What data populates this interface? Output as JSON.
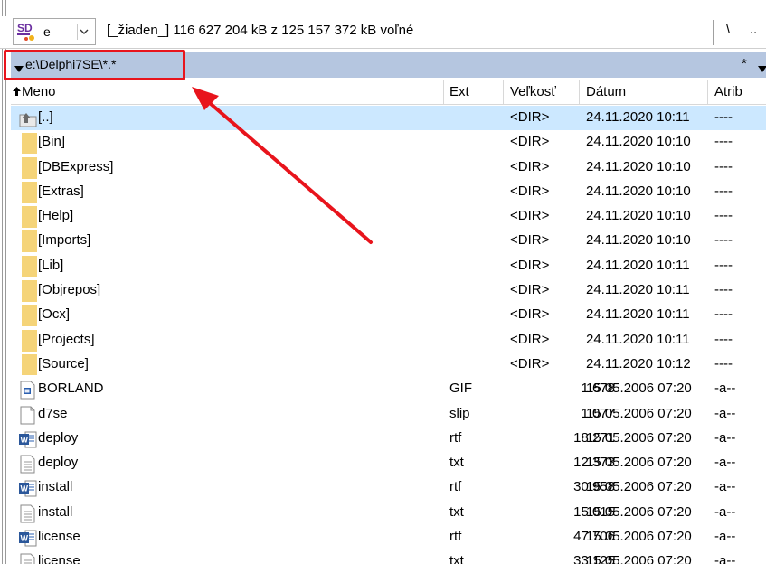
{
  "drive": {
    "letter": "e",
    "info": "[_žiaden_]  116 627 204 kB z 125 157 372 kB voľné",
    "root_button": "\\",
    "up_button": ".."
  },
  "path": {
    "text": "e:\\Delphi7SE\\*.*",
    "filter": "*"
  },
  "columns": {
    "name": "Meno",
    "ext": "Ext",
    "size": "Veľkosť",
    "date": "Dátum",
    "attr": "Atrib"
  },
  "rows": [
    {
      "name": "[..]",
      "ext": "",
      "size": "<DIR>",
      "date": "24.11.2020 10:11",
      "attr": "----",
      "icon": "up-folder-icon"
    },
    {
      "name": "[Bin]",
      "ext": "",
      "size": "<DIR>",
      "date": "24.11.2020 10:10",
      "attr": "----",
      "icon": "folder-icon"
    },
    {
      "name": "[DBExpress]",
      "ext": "",
      "size": "<DIR>",
      "date": "24.11.2020 10:10",
      "attr": "----",
      "icon": "folder-icon"
    },
    {
      "name": "[Extras]",
      "ext": "",
      "size": "<DIR>",
      "date": "24.11.2020 10:10",
      "attr": "----",
      "icon": "folder-icon"
    },
    {
      "name": "[Help]",
      "ext": "",
      "size": "<DIR>",
      "date": "24.11.2020 10:10",
      "attr": "----",
      "icon": "folder-icon"
    },
    {
      "name": "[Imports]",
      "ext": "",
      "size": "<DIR>",
      "date": "24.11.2020 10:10",
      "attr": "----",
      "icon": "folder-icon"
    },
    {
      "name": "[Lib]",
      "ext": "",
      "size": "<DIR>",
      "date": "24.11.2020 10:11",
      "attr": "----",
      "icon": "folder-icon"
    },
    {
      "name": "[Objrepos]",
      "ext": "",
      "size": "<DIR>",
      "date": "24.11.2020 10:11",
      "attr": "----",
      "icon": "folder-icon"
    },
    {
      "name": "[Ocx]",
      "ext": "",
      "size": "<DIR>",
      "date": "24.11.2020 10:11",
      "attr": "----",
      "icon": "folder-icon"
    },
    {
      "name": "[Projects]",
      "ext": "",
      "size": "<DIR>",
      "date": "24.11.2020 10:11",
      "attr": "----",
      "icon": "folder-icon"
    },
    {
      "name": "[Source]",
      "ext": "",
      "size": "<DIR>",
      "date": "24.11.2020 10:12",
      "attr": "----",
      "icon": "folder-icon"
    },
    {
      "name": "BORLAND",
      "ext": "GIF",
      "size": "1 678",
      "date": "15.05.2006 07:20",
      "attr": "-a--",
      "icon": "image-file-icon"
    },
    {
      "name": "d7se",
      "ext": "slip",
      "size": "1 077",
      "date": "15.05.2006 07:20",
      "attr": "-a--",
      "icon": "blank-file-icon"
    },
    {
      "name": "deploy",
      "ext": "rtf",
      "size": "18 271",
      "date": "15.05.2006 07:20",
      "attr": "-a--",
      "icon": "word-file-icon"
    },
    {
      "name": "deploy",
      "ext": "txt",
      "size": "12 373",
      "date": "15.05.2006 07:20",
      "attr": "-a--",
      "icon": "text-file-icon"
    },
    {
      "name": "install",
      "ext": "rtf",
      "size": "30 958",
      "date": "15.05.2006 07:20",
      "attr": "-a--",
      "icon": "word-file-icon"
    },
    {
      "name": "install",
      "ext": "txt",
      "size": "15 015",
      "date": "15.05.2006 07:20",
      "attr": "-a--",
      "icon": "text-file-icon"
    },
    {
      "name": "license",
      "ext": "rtf",
      "size": "47 706",
      "date": "15.05.2006 07:20",
      "attr": "-a--",
      "icon": "word-file-icon"
    },
    {
      "name": "license",
      "ext": "txt",
      "size": "33 125",
      "date": "15.05.2006 07:20",
      "attr": "-a--",
      "icon": "text-file-icon"
    }
  ],
  "colors": {
    "path_bar": "#b5c6e0",
    "selected_row": "#cce8ff",
    "annotation_red": "#e8141c",
    "folder": "#f5d479"
  }
}
